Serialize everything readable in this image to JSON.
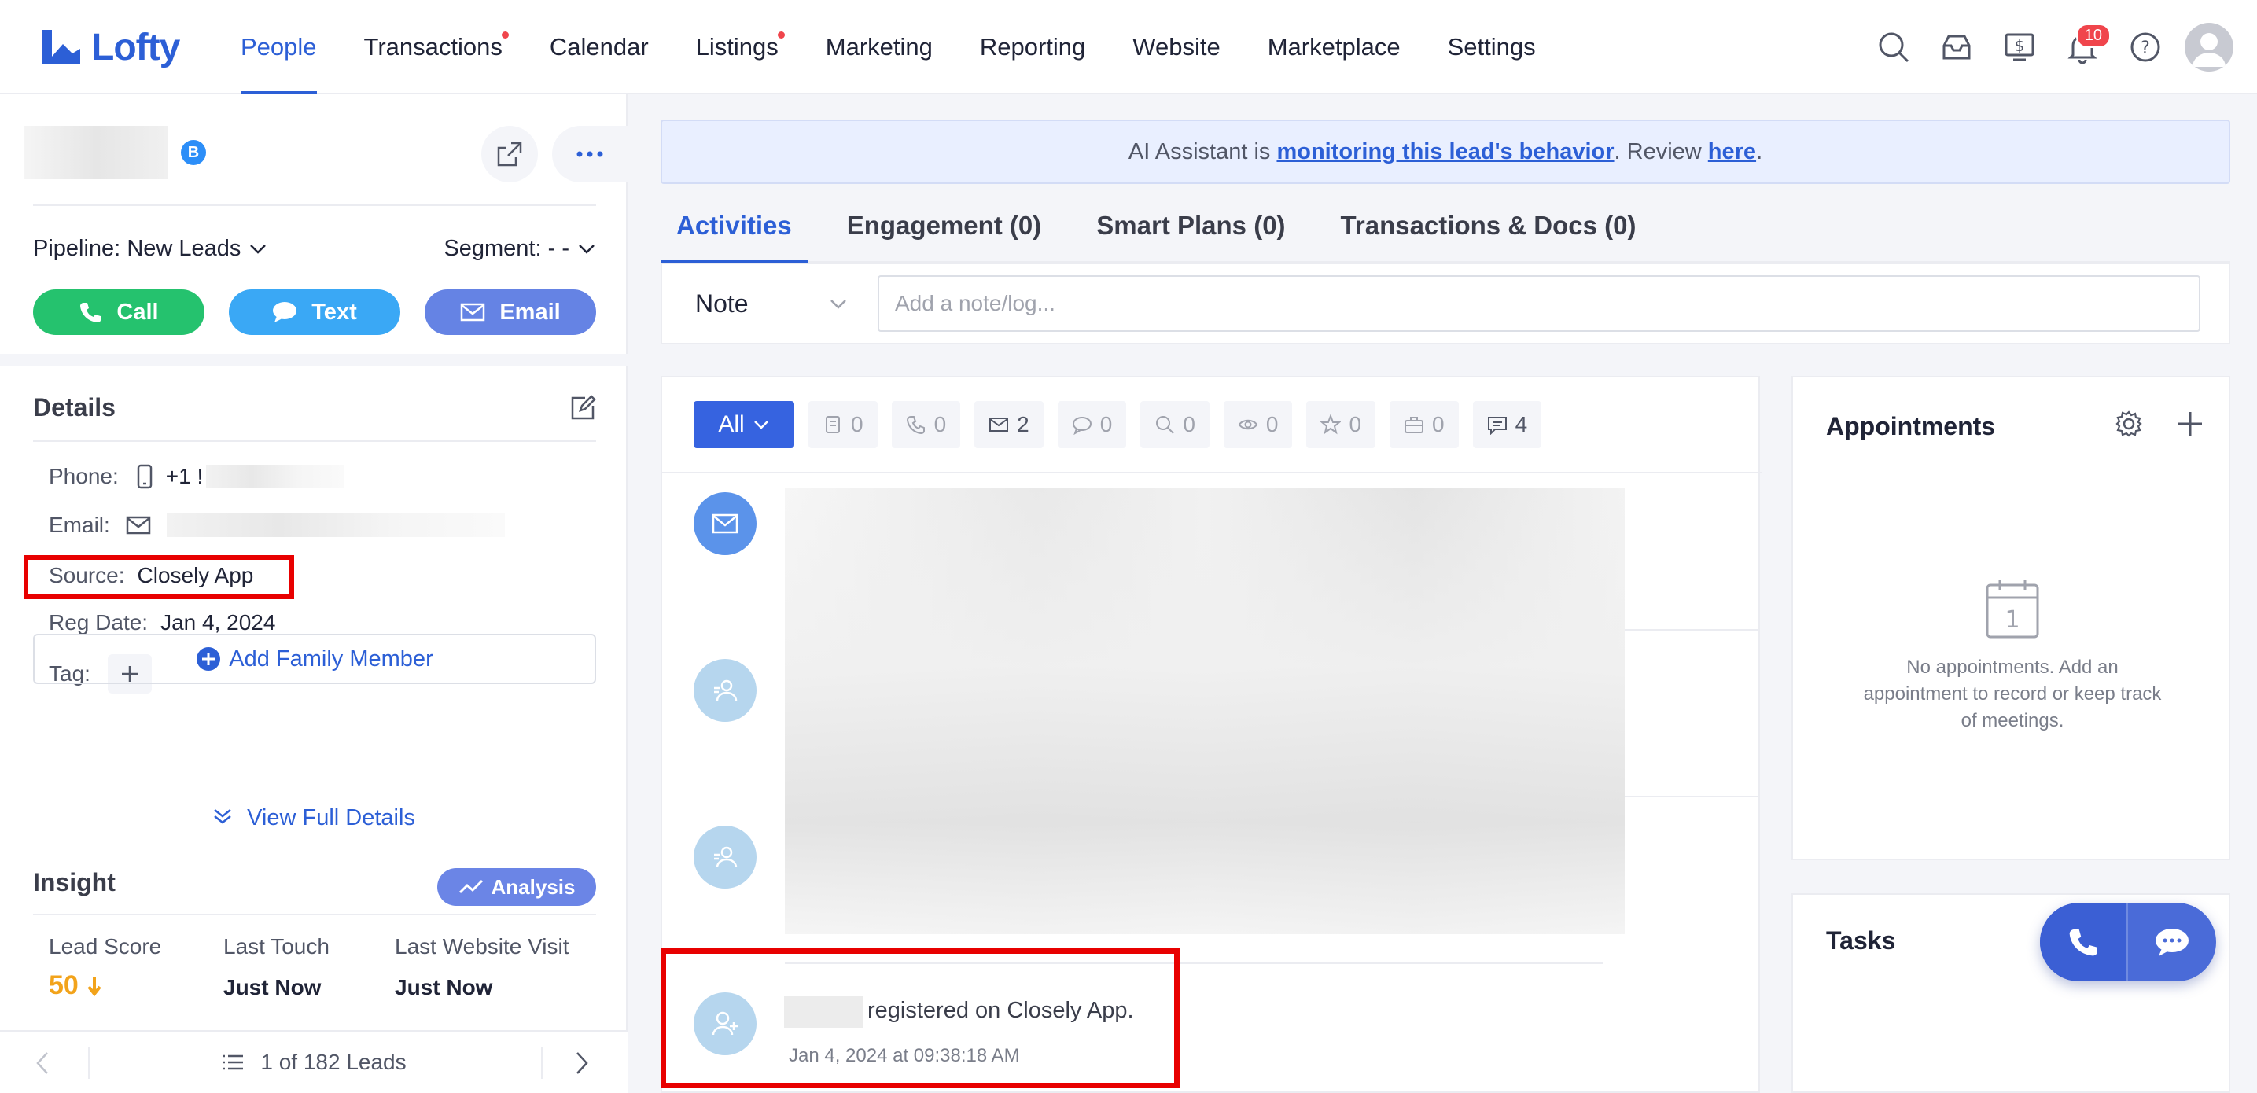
{
  "brand": {
    "name": "Lofty"
  },
  "nav": {
    "items": [
      {
        "label": "People",
        "active": true,
        "dot": false
      },
      {
        "label": "Transactions",
        "active": false,
        "dot": true
      },
      {
        "label": "Calendar",
        "active": false,
        "dot": false
      },
      {
        "label": "Listings",
        "active": false,
        "dot": true
      },
      {
        "label": "Marketing",
        "active": false,
        "dot": false
      },
      {
        "label": "Reporting",
        "active": false,
        "dot": false
      },
      {
        "label": "Website",
        "active": false,
        "dot": false
      },
      {
        "label": "Marketplace",
        "active": false,
        "dot": false
      },
      {
        "label": "Settings",
        "active": false,
        "dot": false
      }
    ],
    "notification_count": "10"
  },
  "lead": {
    "badge": "B",
    "pipeline_label": "Pipeline:",
    "pipeline_value": "New Leads",
    "segment_label": "Segment:",
    "segment_value": "- -",
    "call_label": "Call",
    "text_label": "Text",
    "email_label": "Email"
  },
  "details": {
    "title": "Details",
    "phone_label": "Phone:",
    "phone_value": "+1 !",
    "email_label": "Email:",
    "source_label": "Source:",
    "source_value": "Closely App",
    "reg_label": "Reg Date:",
    "reg_value": "Jan 4, 2024",
    "tag_label": "Tag:",
    "add_family": "Add Family Member",
    "view_full": "View Full Details"
  },
  "insight": {
    "title": "Insight",
    "analysis": "Analysis",
    "lead_score_label": "Lead Score",
    "lead_score_value": "50",
    "last_touch_label": "Last Touch",
    "last_touch_value": "Just Now",
    "last_visit_label": "Last Website Visit",
    "last_visit_value": "Just Now"
  },
  "pager": {
    "text": "1 of 182 Leads"
  },
  "ai_banner": {
    "prefix": "AI Assistant is ",
    "link1": "monitoring this lead's behavior",
    "middle": ". Review ",
    "link2": "here",
    "suffix": "."
  },
  "tabs": [
    {
      "label": "Activities",
      "active": true
    },
    {
      "label": "Engagement (0)",
      "active": false
    },
    {
      "label": "Smart Plans (0)",
      "active": false
    },
    {
      "label": "Transactions & Docs (0)",
      "active": false
    }
  ],
  "note": {
    "type": "Note",
    "placeholder": "Add a note/log..."
  },
  "filters": {
    "all": "All",
    "chips": [
      {
        "icon": "document-icon",
        "count": "0"
      },
      {
        "icon": "phone-icon",
        "count": "0"
      },
      {
        "icon": "mail-icon",
        "count": "2"
      },
      {
        "icon": "chat-icon",
        "count": "0"
      },
      {
        "icon": "search-icon",
        "count": "0"
      },
      {
        "icon": "eye-icon",
        "count": "0"
      },
      {
        "icon": "star-icon",
        "count": "0"
      },
      {
        "icon": "briefcase-icon",
        "count": "0"
      },
      {
        "icon": "message-icon",
        "count": "4"
      }
    ]
  },
  "timeline": {
    "registered_text": "registered on Closely App.",
    "registered_time": "Jan 4, 2024 at 09:38:18 AM"
  },
  "appointments": {
    "title": "Appointments",
    "calendar_day": "1",
    "empty_text": "No appointments. Add an appointment to record or keep track of meetings."
  },
  "tasks": {
    "title": "Tasks"
  }
}
